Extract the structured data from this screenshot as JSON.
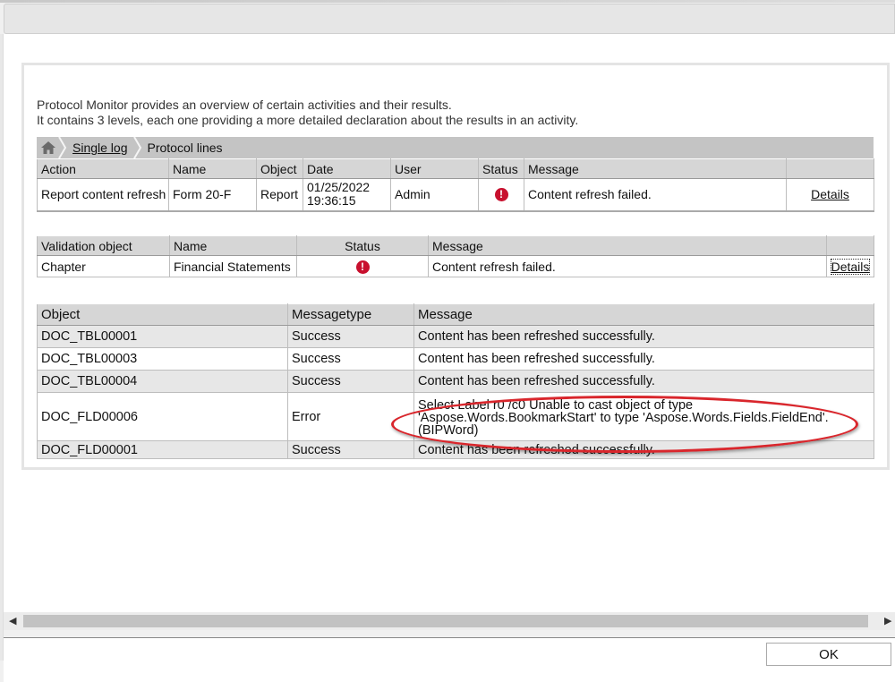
{
  "intro": {
    "line1": "Protocol Monitor provides an overview of certain activities and their results.",
    "line2": "It contains 3 levels, each one providing a more detailed declaration about the results in an activity."
  },
  "breadcrumb": {
    "home_icon": "home-icon",
    "items": [
      {
        "label": "Single log",
        "link": true
      },
      {
        "label": "Protocol lines",
        "link": false
      }
    ]
  },
  "activity_table": {
    "headers": [
      "Action",
      "Name",
      "Object",
      "Date",
      "User",
      "Status",
      "Message",
      ""
    ],
    "row": {
      "action": "Report content refresh",
      "name": "Form 20-F",
      "object": "Report",
      "date": "01/25/2022",
      "time": "19:36:15",
      "user": "Admin",
      "status_icon": "error-icon",
      "message": "Content refresh failed.",
      "details": "Details"
    }
  },
  "validation_table": {
    "headers": [
      "Validation object",
      "Name",
      "Status",
      "Message",
      ""
    ],
    "row": {
      "object": "Chapter",
      "name": "Financial Statements",
      "status_icon": "error-icon",
      "message": "Content refresh failed.",
      "details": "Details"
    }
  },
  "lines_table": {
    "headers": [
      "Object",
      "Messagetype",
      "Message"
    ],
    "rows": [
      {
        "object": "DOC_TBL00001",
        "type": "Success",
        "message": "Content has been refreshed successfully."
      },
      {
        "object": "DOC_TBL00003",
        "type": "Success",
        "message": "Content has been refreshed successfully."
      },
      {
        "object": "DOC_TBL00004",
        "type": "Success",
        "message": "Content has been refreshed successfully."
      },
      {
        "object": "DOC_FLD00006",
        "type": "Error",
        "message": "Select Label r0 /c0 Unable to cast object of type 'Aspose.Words.BookmarkStart' to type 'Aspose.Words.Fields.FieldEnd'. (BIPWord)"
      },
      {
        "object": "DOC_FLD00001",
        "type": "Success",
        "message": "Content has been refreshed successfully."
      }
    ]
  },
  "colors": {
    "error": "#c8102e",
    "highlight": "#d9262c"
  },
  "footer": {
    "ok_label": "OK"
  }
}
